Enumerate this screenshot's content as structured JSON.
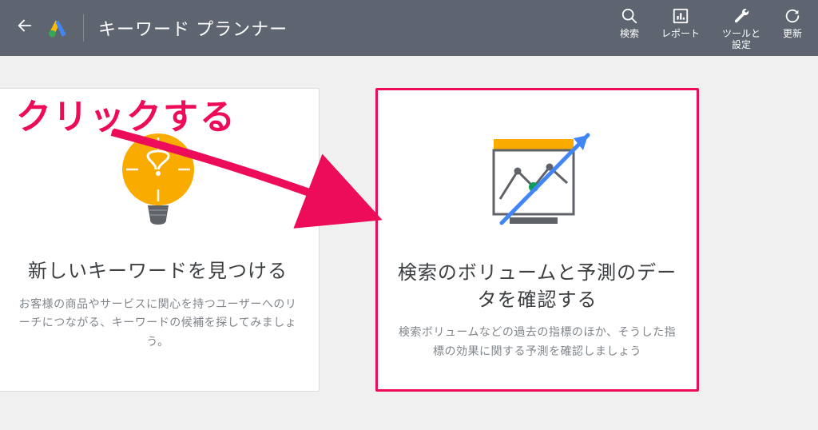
{
  "header": {
    "title": "キーワード プランナー",
    "actions": {
      "search": "検索",
      "report": "レポート",
      "tools": "ツールと\n設定",
      "refresh": "更新"
    }
  },
  "cards": {
    "discover": {
      "title": "新しいキーワードを見つける",
      "desc": "お客様の商品やサービスに関心を持つユーザーへのリーチにつながる、キーワードの候補を探してみましょう。"
    },
    "volume": {
      "title": "検索のボリュームと予測のデータを確認する",
      "desc": "検索ボリュームなどの過去の指標のほか、そうした指標の効果に関する予測を確認しましょう"
    }
  },
  "annotation": {
    "click_label": "クリックする"
  }
}
